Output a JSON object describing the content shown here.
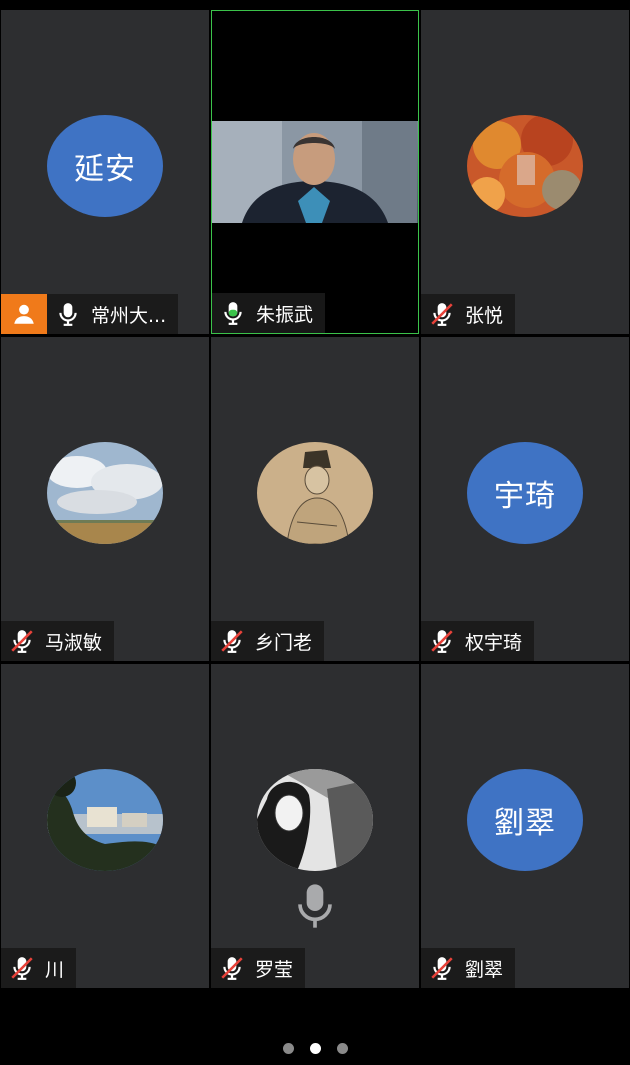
{
  "participants": [
    {
      "name": "常州大...",
      "avatar_text": "延安",
      "mic": "on",
      "host": true
    },
    {
      "name": "朱振武",
      "mic": "active",
      "video": true
    },
    {
      "name": "张悦",
      "mic": "muted",
      "avatar_image": "autumn-leaves"
    },
    {
      "name": "马淑敏",
      "mic": "muted",
      "avatar_image": "clouds-field"
    },
    {
      "name": "乡门老",
      "mic": "muted",
      "avatar_image": "ink-portrait"
    },
    {
      "name": "权宇琦",
      "avatar_text": "宇琦",
      "mic": "muted"
    },
    {
      "name": "川",
      "mic": "muted",
      "avatar_image": "city-hill"
    },
    {
      "name": "罗莹",
      "mic": "muted",
      "avatar_image": "bw-portrait",
      "speaking_icon": "microphone-icon"
    },
    {
      "name": "劉翠",
      "avatar_text": "劉翠",
      "mic": "muted"
    }
  ],
  "pager": {
    "pages": 3,
    "current": 2
  },
  "colors": {
    "avatar_blue": "#3f73c4",
    "active_border": "#3bc24a",
    "host_orange": "#f07a1a",
    "tile_bg": "#2d2e30"
  }
}
